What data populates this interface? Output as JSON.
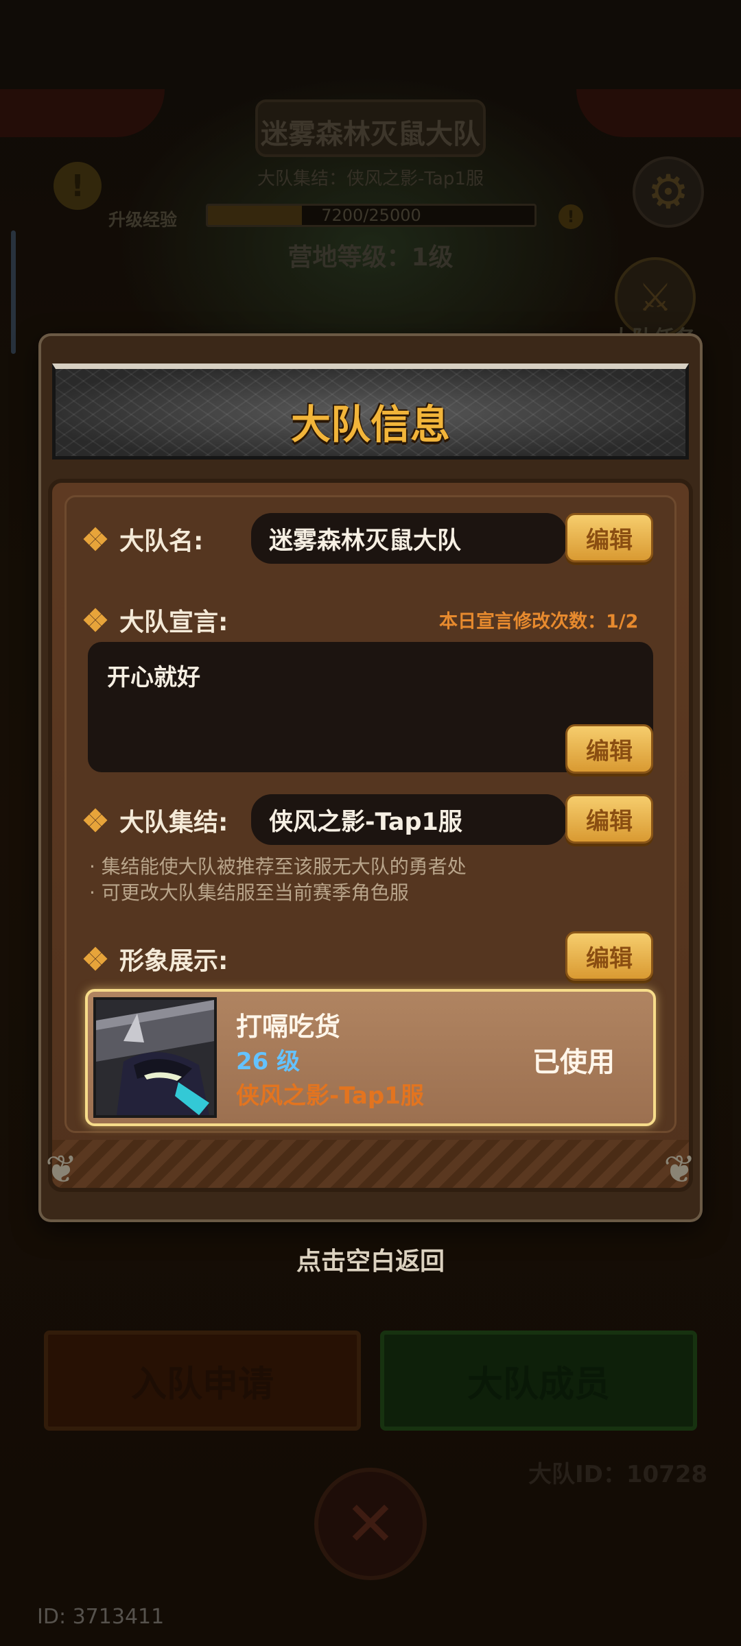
{
  "background": {
    "team_title": "迷雾森林灭鼠大队",
    "rally_line": "大队集结：侠风之影-Tap1服",
    "exp_label": "升级经验",
    "exp_text": "7200/25000",
    "exp_progress": 0.288,
    "camp_level": "营地等级：1级",
    "team_task_label": "大队任务",
    "join_request_button": "入队申请",
    "members_button": "大队成员",
    "team_id": "大队ID：10728",
    "user_id": "ID: 3713411",
    "warn_icon": "!",
    "coin_icon": "!"
  },
  "modal": {
    "title": "大队信息",
    "name_label": "大队名:",
    "name_value": "迷雾森林灭鼠大队",
    "motto_label": "大队宣言:",
    "motto_edit_count": "本日宣言修改次数：1/2",
    "motto_value": "开心就好",
    "rally_label": "大队集结:",
    "rally_value": "侠风之影-Tap1服",
    "rally_notes": [
      "· 集结能使大队被推荐至该服无大队的勇者处",
      "· 可更改大队集结服至当前赛季角色服"
    ],
    "display_label": "形象展示:",
    "edit_label": "编辑",
    "character": {
      "name": "打嗝吃货",
      "level": "26 级",
      "server": "侠风之影-Tap1服",
      "status": "已使用"
    }
  },
  "return_hint": "点击空白返回",
  "colors": {
    "accent_gold": "#f2b53a",
    "edit_button": "#e8b350",
    "level_blue": "#64c2ff",
    "server_orange": "#e3741f"
  }
}
